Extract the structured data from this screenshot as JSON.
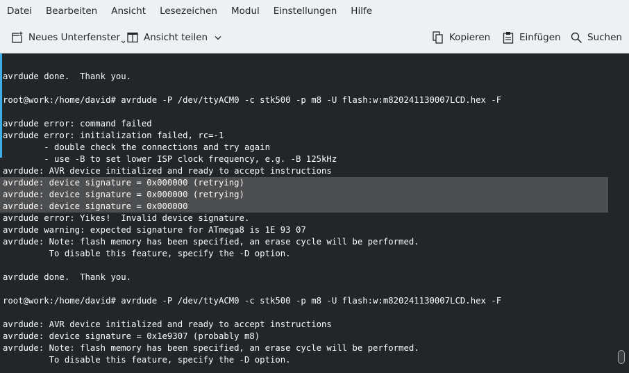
{
  "menu": [
    "Datei",
    "Bearbeiten",
    "Ansicht",
    "Lesezeichen",
    "Modul",
    "Einstellungen",
    "Hilfe"
  ],
  "toolbar": {
    "new_window": "Neues Unterfenster",
    "split_view": "Ansicht teilen",
    "copy": "Kopieren",
    "paste": "Einfügen",
    "search": "Suchen"
  },
  "terminal": {
    "lines": [
      "",
      "avrdude done.  Thank you.",
      "",
      "root@work:/home/david# avrdude -P /dev/ttyACM0 -c stk500 -p m8 -U flash:w:m820241130007LCD.hex -F",
      "",
      "avrdude error: command failed",
      "avrdude error: initialization failed, rc=-1",
      "        - double check the connections and try again",
      "        - use -B to set lower ISP clock frequency, e.g. -B 125kHz",
      "avrdude: AVR device initialized and ready to accept instructions",
      "avrdude: device signature = 0x000000 (retrying)",
      "avrdude: device signature = 0x000000 (retrying)",
      "avrdude: device signature = 0x000000",
      "avrdude error: Yikes!  Invalid device signature.",
      "avrdude warning: expected signature for ATmega8 is 1E 93 07",
      "avrdude: Note: flash memory has been specified, an erase cycle will be performed.",
      "         To disable this feature, specify the -D option.",
      "",
      "avrdude done.  Thank you.",
      "",
      "root@work:/home/david# avrdude -P /dev/ttyACM0 -c stk500 -p m8 -U flash:w:m820241130007LCD.hex -F",
      "",
      "avrdude: AVR device initialized and ready to accept instructions",
      "avrdude: device signature = 0x1e9307 (probably m8)",
      "avrdude: Note: flash memory has been specified, an erase cycle will be performed.",
      "         To disable this feature, specify the -D option."
    ],
    "highlighted_rows": [
      10,
      11,
      12
    ]
  },
  "colors": {
    "background": "#232629",
    "text": "#fcfcfc",
    "selection": "#4d4e50",
    "accent": "#3daee9"
  }
}
